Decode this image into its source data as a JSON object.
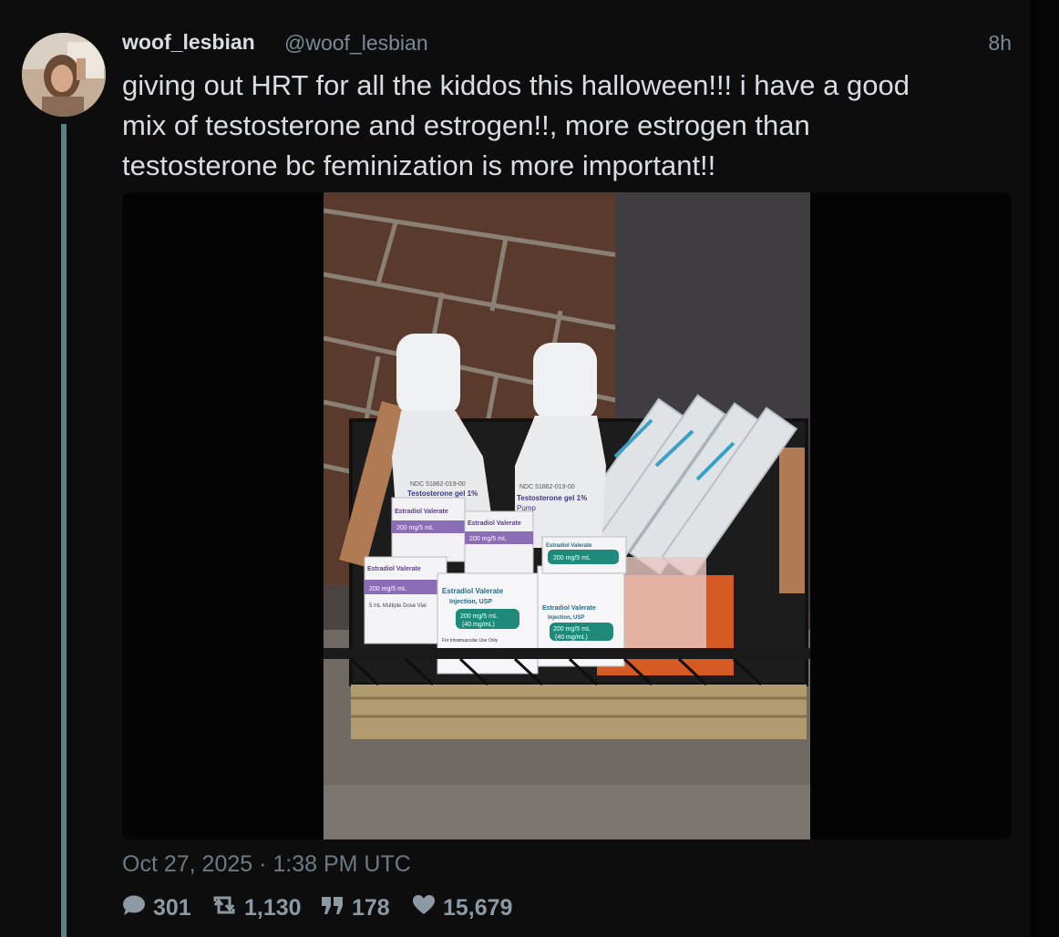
{
  "tweet": {
    "username": "woof_lesbian",
    "handle": "@woof_lesbian",
    "time_ago": "8h",
    "text_lines": [
      "giving out HRT for all the kiddos this halloween!!! i have a good",
      "mix of testosterone and estrogen!!, more estrogen than",
      "testosterone bc feminization is more important!!"
    ],
    "date": "Oct 27, 2025 · 1:38 PM UTC"
  },
  "media": {
    "bottle_left": {
      "line1": "NDC 51862-019-00",
      "line2": "Testosterone gel 1%"
    },
    "bottle_right": {
      "line1": "NDC 51862-019-00",
      "line2": "Testosterone gel 1%",
      "line3": "Pump"
    },
    "box_label": {
      "name": "Estradiol Valerate",
      "sub": "Injection, USP",
      "dose": "200 mg/5 mL",
      "conc": "(40 mg/mL)",
      "vial": "5 mL Multiple Dose Vial",
      "route": "For Intramuscular Use Only"
    }
  },
  "stats": {
    "replies": "301",
    "retweets": "1,130",
    "quotes": "178",
    "likes": "15,679"
  },
  "icons": {
    "replies": "comment-icon",
    "retweets": "retweet-icon",
    "quotes": "quote-icon",
    "likes": "heart-icon"
  },
  "colors": {
    "background": "#0d0d0d",
    "thread_line": "#5f7e86",
    "text": "#d8dde2",
    "muted": "#7c8a95"
  }
}
